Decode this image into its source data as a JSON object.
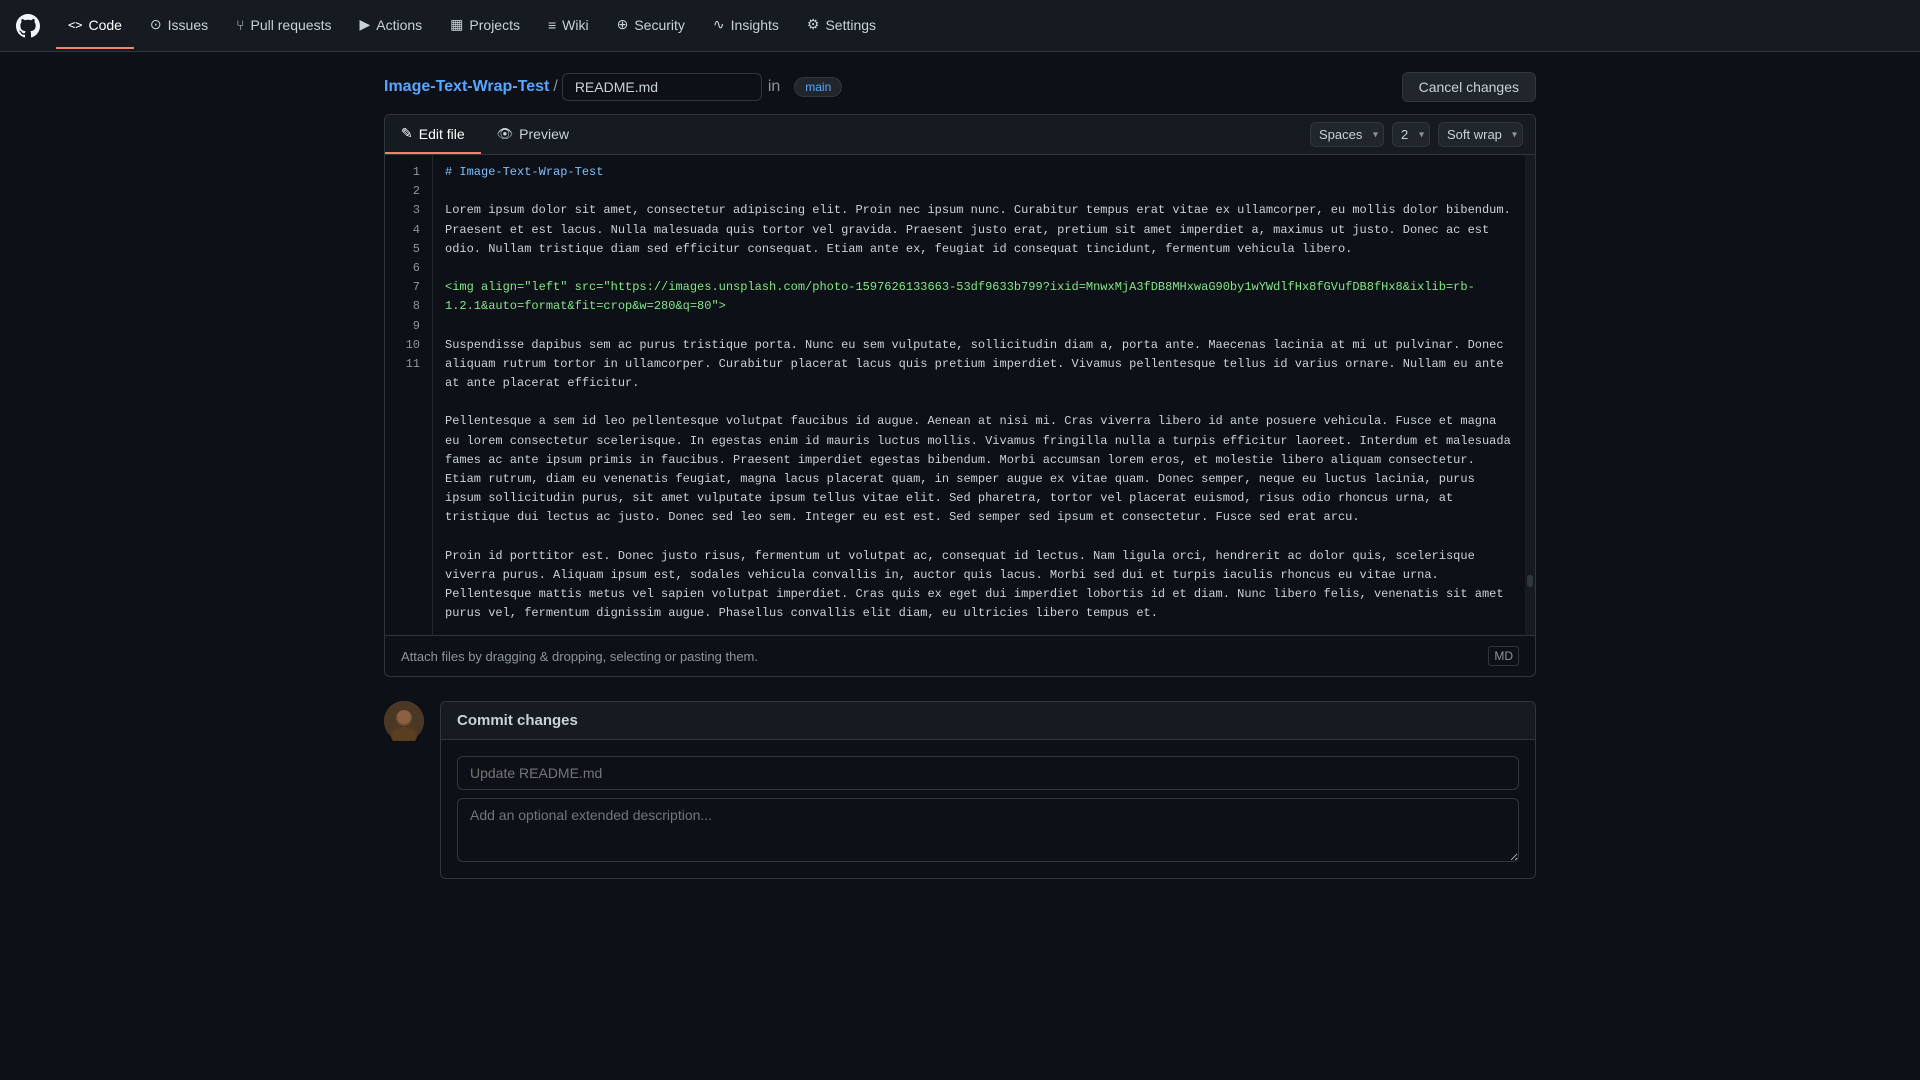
{
  "nav": {
    "logo": "⬡",
    "tabs": [
      {
        "id": "code",
        "label": "Code",
        "icon": "</>",
        "active": true
      },
      {
        "id": "issues",
        "label": "Issues",
        "icon": "○"
      },
      {
        "id": "pull-requests",
        "label": "Pull requests",
        "icon": "⑂"
      },
      {
        "id": "actions",
        "label": "Actions",
        "icon": "▶"
      },
      {
        "id": "projects",
        "label": "Projects",
        "icon": "▦"
      },
      {
        "id": "wiki",
        "label": "Wiki",
        "icon": "≡"
      },
      {
        "id": "security",
        "label": "Security",
        "icon": "⊕"
      },
      {
        "id": "insights",
        "label": "Insights",
        "icon": "∼"
      },
      {
        "id": "settings",
        "label": "Settings",
        "icon": "⚙"
      }
    ]
  },
  "breadcrumb": {
    "repo": "Image-Text-Wrap-Test",
    "separator": "/",
    "filename": "README.md",
    "in_text": "in",
    "branch": "main"
  },
  "cancel_button": "Cancel changes",
  "editor": {
    "tabs": [
      {
        "id": "edit-file",
        "label": "Edit file",
        "icon": "✎",
        "active": true
      },
      {
        "id": "preview",
        "label": "Preview",
        "icon": "👁",
        "active": false
      }
    ],
    "controls": {
      "indent_type": "Spaces",
      "indent_size": "2",
      "wrap": "Soft wrap"
    },
    "lines": [
      {
        "num": 1,
        "type": "heading",
        "content": "# Image-Text-Wrap-Test"
      },
      {
        "num": 2,
        "type": "empty",
        "content": ""
      },
      {
        "num": 3,
        "type": "text",
        "content": "Lorem ipsum dolor sit amet, consectetur adipiscing elit. Proin nec ipsum nunc. Curabitur tempus erat vitae ex ullamcorper, eu mollis dolor bibendum. Praesent et est lacus. Nulla malesuada quis tortor vel gravida. Praesent justo erat, pretium sit amet imperdiet a, maximus ut justo. Donec ac est odio. Nullam tristique diam sed efficitur consequat. Etiam ante ex, feugiat id consequat tincidunt, fermentum vehicula libero."
      },
      {
        "num": 4,
        "type": "empty",
        "content": ""
      },
      {
        "num": 5,
        "type": "tag",
        "content": "<img align=\"left\" src=\"https://images.unsplash.com/photo-1597626133663-53df9633b799?ixid=MnwxMjA3fDB8MHxwaG90by1wYWdlfHx8fGVufDB8fHx8&ixlib=rb-1.2.1&auto=format&fit=crop&w=280&q=80\">"
      },
      {
        "num": 6,
        "type": "empty",
        "content": ""
      },
      {
        "num": 7,
        "type": "text",
        "content": "Suspendisse dapibus sem ac purus tristique porta. Nunc eu sem vulputate, sollicitudin diam a, porta ante. Maecenas lacinia at mi ut pulvinar. Donec aliquam rutrum tortor in ullamcorper. Curabitur placerat lacus quis pretium imperdiet. Vivamus pellentesque tellus id varius ornare. Nullam eu ante at ante placerat efficitur."
      },
      {
        "num": 8,
        "type": "empty",
        "content": ""
      },
      {
        "num": 9,
        "type": "text",
        "content": "Pellentesque a sem id leo pellentesque volutpat faucibus id augue. Aenean at nisi mi. Cras viverra libero id ante posuere vehicula. Fusce et magna eu lorem consectetur scelerisque. In egestas enim id mauris luctus mollis. Vivamus fringilla nulla a turpis efficitur laoreet. Interdum et malesuada fames ac ante ipsum primis in faucibus. Praesent imperdiet egestas bibendum. Morbi accumsan lorem eros, et molestie libero aliquam consectetur. Etiam rutrum, diam eu venenatis feugiat, magna lacus placerat quam, in semper augue ex vitae quam. Donec semper, neque eu luctus lacinia, purus ipsum sollicitudin purus, sit amet vulputate ipsum tellus vitae elit. Sed pharetra, tortor vel placerat euismod, risus odio rhoncus urna, at tristique dui lectus ac justo. Donec sed leo sem. Integer eu est est. Sed semper sed ipsum et consectetur. Fusce sed erat arcu."
      },
      {
        "num": 10,
        "type": "empty",
        "content": ""
      },
      {
        "num": 11,
        "type": "text",
        "content": "Proin id porttitor est. Donec justo risus, fermentum ut volutpat ac, consequat id lectus. Nam ligula orci, hendrerit ac dolor quis, scelerisque viverra purus. Aliquam ipsum est, sodales vehicula convallis in, auctor quis lacus. Morbi sed dui et turpis iaculis rhoncus eu vitae urna. Pellentesque mattis metus vel sapien volutpat imperdiet. Cras quis ex eget dui imperdiet lobortis id et diam. Nunc libero felis, venenatis sit amet purus vel, fermentum dignissim augue. Phasellus convallis elit diam, eu ultricies libero tempus et."
      }
    ],
    "attach_bar": "Attach files by dragging & dropping, selecting or pasting them."
  },
  "commit": {
    "title": "Commit changes",
    "title_placeholder": "Update README.md",
    "desc_placeholder": "Add an optional extended description..."
  }
}
